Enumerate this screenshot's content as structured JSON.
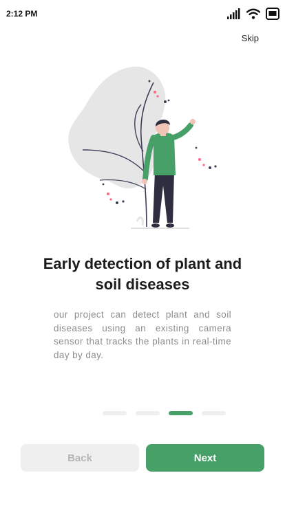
{
  "status_bar": {
    "time": "2:12 PM",
    "icons": [
      "signal-icon",
      "wifi-icon",
      "battery-icon"
    ]
  },
  "header": {
    "skip_label": "Skip"
  },
  "illustration": {
    "name": "person-with-plant-illustration",
    "colors": {
      "leaf": "#e6e6e6",
      "shirt": "#46a068",
      "pants": "#2f2e41",
      "skin": "#f2c4b6",
      "accent": "#ff6584"
    }
  },
  "content": {
    "title": "Early detection of plant and soil diseases",
    "description": "our project can detect plant and soil diseases using an existing camera sensor that tracks the plants in real-time day by day."
  },
  "pager": {
    "total": 4,
    "active_index": 2
  },
  "footer": {
    "back_label": "Back",
    "next_label": "Next"
  },
  "theme": {
    "accent": "#46a068",
    "disabled_bg": "#efefef",
    "disabled_text": "#b6b6b6"
  }
}
